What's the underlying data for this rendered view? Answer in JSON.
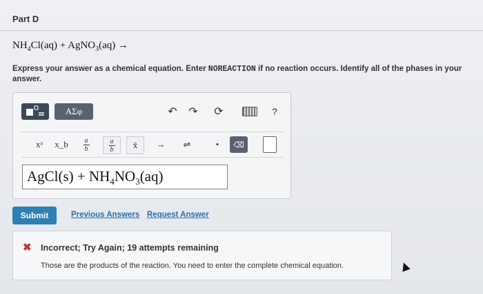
{
  "part": {
    "title": "Part D"
  },
  "question": {
    "nh": "NH",
    "sub4": "4",
    "rest1": "Cl(aq) + AgNO",
    "sub3": "3",
    "rest2": "(aq) →"
  },
  "instructions": {
    "before": "Express your answer as a chemical equation. Enter ",
    "keyword": "NOREACTION",
    "after": " if no reaction occurs. Identify all of the phases in your answer."
  },
  "toolbar": {
    "greek_label": "ΑΣφ",
    "undo_icon": "↶",
    "redo_icon": "↷",
    "reset_icon": "⟳",
    "help_label": "?"
  },
  "toolbar2": {
    "superscript": "xᵃ",
    "subscript": "x_b",
    "frac_num": "a",
    "frac_den": "b",
    "vec": "x̄",
    "arrow": "→",
    "equilibrium": "⇌",
    "dot": "•",
    "delete_icon": "⌫"
  },
  "answer": {
    "p1": "AgCl(s) + NH",
    "sub4": "4",
    "p2": "NO",
    "sub3": "3",
    "p3": "(aq)"
  },
  "actions": {
    "submit": "Submit",
    "previous_answers": "Previous Answers",
    "request_answer": "Request Answer"
  },
  "feedback": {
    "status_icon": "✖",
    "title": "Incorrect; Try Again; 19 attempts remaining",
    "body": "Those are the products of the reaction. You need to enter the complete chemical equation."
  }
}
